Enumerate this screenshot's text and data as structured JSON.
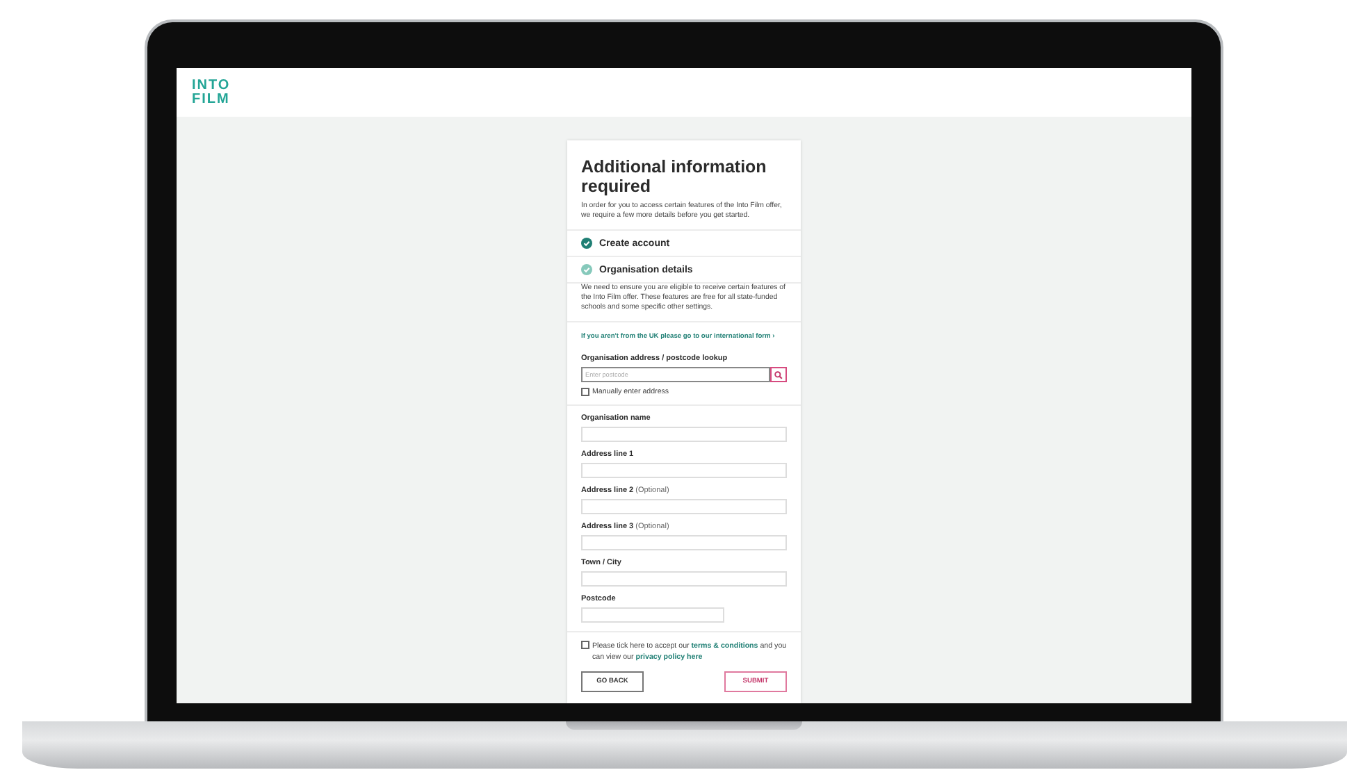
{
  "logo": [
    "INTO",
    "FILM"
  ],
  "form": {
    "title": "Additional information required",
    "intro": "In order for you to access certain features of the Into Film offer, we require a few more details before you get started.",
    "steps": [
      {
        "label": "Create account",
        "completed": true
      },
      {
        "label": "Organisation details",
        "completed": false
      }
    ],
    "eligibility": "We need to ensure you are eligible to receive certain features of the Into Film offer. These features are free for all state-funded schools and some specific other settings.",
    "international_link": "If you aren't from the UK please go to our international form ›",
    "lookup": {
      "label": "Organisation address / postcode lookup",
      "placeholder": "Enter postcode"
    },
    "manual": {
      "label": "Manually enter address",
      "checked": false
    },
    "fields": [
      {
        "label": "Organisation name",
        "short": false
      },
      {
        "label": "Address line 1",
        "short": false
      },
      {
        "label": "Address line 2",
        "optional": "(Optional)",
        "short": false
      },
      {
        "label": "Address line 3",
        "optional": "(Optional)",
        "short": false
      },
      {
        "label": "Town / City",
        "short": false
      },
      {
        "label": "Postcode",
        "short": true
      }
    ],
    "terms": {
      "checked": false,
      "parts": [
        {
          "kind": "text",
          "text": "Please tick here to accept our"
        },
        {
          "kind": "link",
          "text": "terms & conditions"
        },
        {
          "kind": "text",
          "text": "and you can view our"
        },
        {
          "kind": "link",
          "text": "privacy policy here"
        }
      ]
    },
    "buttons": [
      {
        "label": "GO BACK",
        "kind": "secondary"
      },
      {
        "label": "SUBMIT",
        "kind": "primary"
      }
    ]
  }
}
